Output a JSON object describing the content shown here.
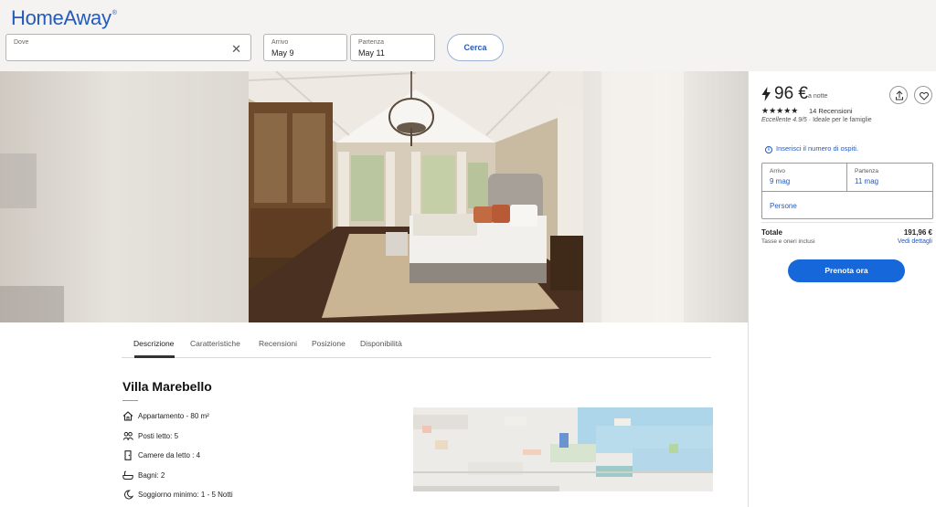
{
  "header": {
    "logo": "HomeAway",
    "logo_mark": "®",
    "search": {
      "where_label": "Dove",
      "where_value": "",
      "checkin_label": "Arrivo",
      "checkin_value": "May 9",
      "checkout_label": "Partenza",
      "checkout_value": "May 11",
      "search_button": "Cerca"
    }
  },
  "tabs": [
    {
      "label": "Descrizione",
      "active": true
    },
    {
      "label": "Caratteristiche",
      "active": false
    },
    {
      "label": "Recensioni",
      "active": false
    },
    {
      "label": "Posizione",
      "active": false
    },
    {
      "label": "Disponibilità",
      "active": false
    }
  ],
  "property": {
    "title": "Villa Marebello",
    "features": [
      {
        "icon": "house-icon",
        "text": "Appartamento - 80 m²"
      },
      {
        "icon": "people-icon",
        "text": "Posti letto: 5"
      },
      {
        "icon": "door-icon",
        "text": "Camere da letto : 4"
      },
      {
        "icon": "bathtub-icon",
        "text": "Bagni: 2"
      },
      {
        "icon": "moon-icon",
        "text": "Soggiorno minimo: 1 - 5 Notti"
      }
    ]
  },
  "sidebar": {
    "price": "96 €",
    "per_night": "a notte",
    "stars": "★★★★★",
    "reviews": "14 Recensioni",
    "rating_text": "Eccellente 4.9/5",
    "rating_sep": "·",
    "rating_tag": "Ideale per le famiglie",
    "info_text": "Inserisci il numero di ospiti.",
    "checkin_label": "Arrivo",
    "checkin_value": "9 mag",
    "checkout_label": "Partenza",
    "checkout_value": "11 mag",
    "guests_label": "Persone",
    "total_label": "Totale",
    "total_value": "191,96 €",
    "taxes_label": "Tasse e oneri inclusi",
    "details_link": "Vedi dettagli",
    "book_button": "Prenota ora"
  },
  "colors": {
    "brand": "#245abc",
    "book_button": "#1667d9",
    "topbar_bg": "#f4f3f2"
  }
}
